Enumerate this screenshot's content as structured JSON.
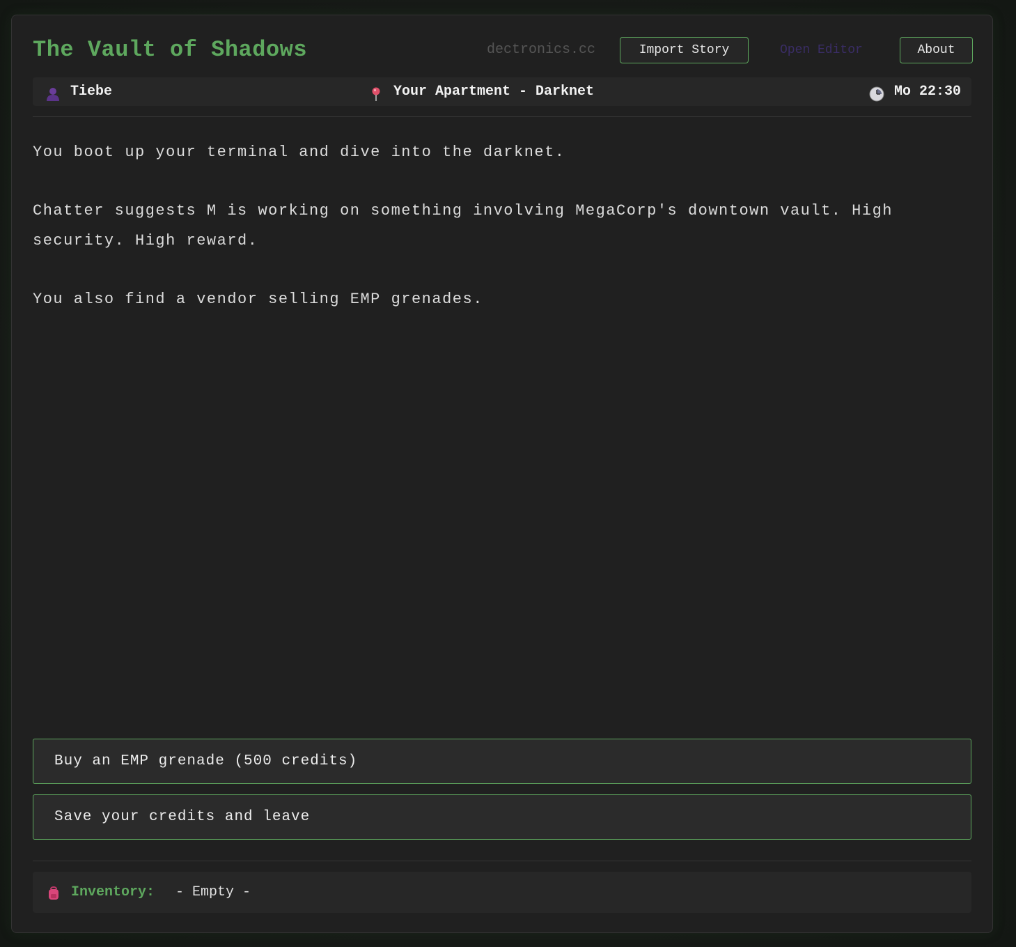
{
  "header": {
    "title": "The Vault of Shadows",
    "site": "dectronics.cc",
    "import_label": "Import Story",
    "editor_label": "Open Editor",
    "about_label": "About"
  },
  "status": {
    "player_icon": "person-icon",
    "player_name": "Tiebe",
    "location_icon": "pin-icon",
    "location": "Your Apartment - Darknet",
    "time_icon": "clock-icon",
    "time": "Mo 22:30"
  },
  "story": {
    "paragraphs": [
      "You boot up your terminal and dive into the darknet.",
      "Chatter suggests M is working on something involving MegaCorp's downtown vault. High security. High reward.",
      "You also find a vendor selling EMP grenades."
    ]
  },
  "choices": [
    "Buy an EMP grenade (500 credits)",
    "Save your credits and leave"
  ],
  "inventory": {
    "icon": "backpack-icon",
    "label": "Inventory:",
    "value": "- Empty -"
  },
  "colors": {
    "accent": "#5ea85e",
    "background": "#202020",
    "editor_link": "#3a2d66"
  }
}
